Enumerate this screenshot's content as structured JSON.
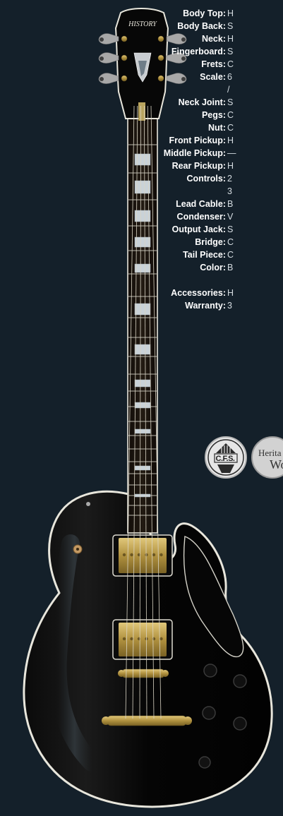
{
  "specs": [
    {
      "label": "Body Top:",
      "value": "H"
    },
    {
      "label": "Body Back:",
      "value": "S"
    },
    {
      "label": "Neck:",
      "value": "H"
    },
    {
      "label": "Fingerboard:",
      "value": "S"
    },
    {
      "label": "Frets:",
      "value": "C"
    },
    {
      "label": "Scale:",
      "value": "6\n/"
    },
    {
      "label": "Neck Joint:",
      "value": "S"
    },
    {
      "label": "Pegs:",
      "value": "C"
    },
    {
      "label": "Nut:",
      "value": "C"
    },
    {
      "label": "Front Pickup:",
      "value": "H"
    },
    {
      "label": "Middle Pickup:",
      "value": "—"
    },
    {
      "label": "Rear Pickup:",
      "value": "H"
    },
    {
      "label": "Controls:",
      "value": "2\n3"
    },
    {
      "label": "Lead Cable:",
      "value": "B"
    },
    {
      "label": "Condenser:",
      "value": "V"
    },
    {
      "label": "Output Jack:",
      "value": "S"
    },
    {
      "label": "Bridge:",
      "value": "C"
    },
    {
      "label": "Tail Piece:",
      "value": "C"
    },
    {
      "label": "Color:",
      "value": "B"
    },
    {
      "label": "Accessories:",
      "value": "H"
    },
    {
      "label": "Warranty:",
      "value": "3"
    }
  ],
  "headstock_logo": "HISTORY",
  "badges": {
    "cfs": "C.F.S.",
    "heritage_top": "Herita",
    "heritage_bottom": "Wo"
  },
  "colors": {
    "background": "#14202a",
    "body": "#050505",
    "binding": "#e8e6dc",
    "hardware_gold": "#c2a456",
    "fretboard": "#17110c"
  }
}
